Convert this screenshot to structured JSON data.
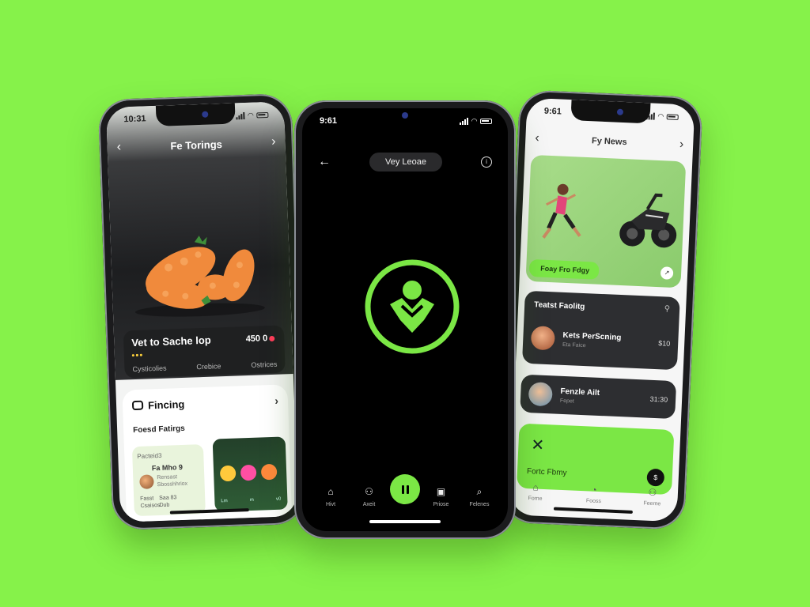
{
  "left": {
    "time": "10:31",
    "title": "Fe Torings",
    "hero_title": "Vet to Sache lop",
    "price": "450 0",
    "meta": [
      "Cysticolies",
      "Crebice",
      "Ostrices"
    ],
    "finding_title": "Fincing",
    "section_title": "Foesd Fatirgs",
    "tile": {
      "label": "Pacteid3",
      "name": "Fa Mho 9",
      "desc": "Rensast\nSbosshhriox",
      "col1": "Fasst\nCsaisos",
      "col2": "Saa 83\nDub"
    },
    "tile_dark_labels": [
      "Lm",
      "m",
      "v0"
    ]
  },
  "center": {
    "time": "9:61",
    "pill": "Vey Leoae",
    "tabs": [
      "Hivt",
      "Axeit",
      "Priose",
      "Felenes"
    ]
  },
  "right": {
    "time": "9:61",
    "title": "Fy News",
    "news_tag": "Foay Fro Fdgy",
    "card1_title": "Teatst Faolitg",
    "row1": {
      "name": "Kets PerScning",
      "sub": "Eta Faice",
      "val": "$10"
    },
    "row2": {
      "name": "Fenzle Ailt",
      "sub": "Fepet",
      "val": "31:30"
    },
    "green_label": "Fortc Fbmy",
    "green_btn": "$",
    "tabs": [
      "Fome",
      "Fooss",
      "Feeme"
    ]
  },
  "colors": {
    "background": "#86f24a",
    "accent": "#7be745",
    "dark_card": "#2d2e31"
  },
  "icons": [
    "back-chevron-icon",
    "forward-chevron-icon",
    "back-arrow-icon",
    "info-icon",
    "brand-logo-icon",
    "pause-icon",
    "home-icon",
    "search-icon",
    "profile-icon",
    "settings-icon",
    "close-x-icon"
  ]
}
